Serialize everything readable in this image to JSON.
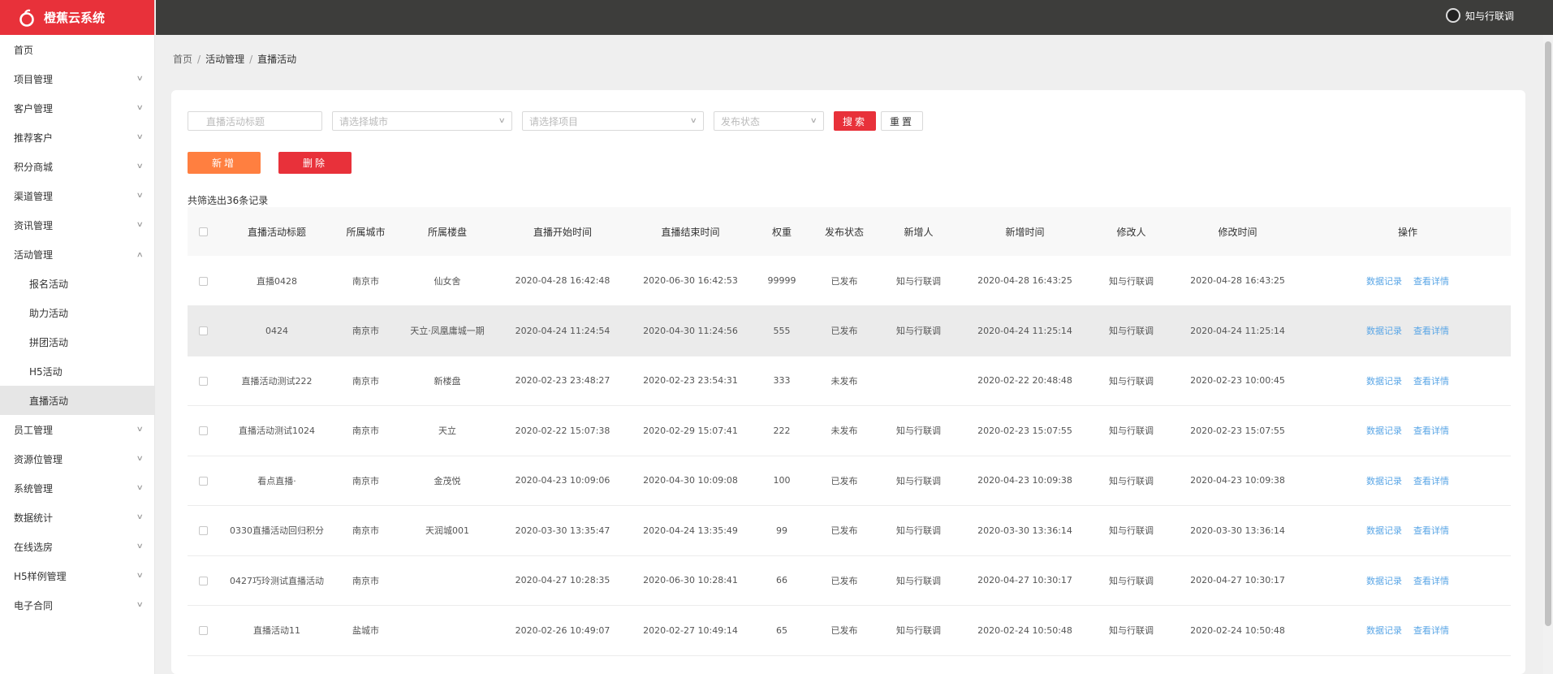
{
  "app": {
    "title": "橙蕉云系统"
  },
  "user": {
    "name": "知与行联调"
  },
  "sidebar": {
    "items": [
      {
        "label": "首页",
        "has_arrow": false
      },
      {
        "label": "项目管理",
        "has_arrow": true
      },
      {
        "label": "客户管理",
        "has_arrow": true
      },
      {
        "label": "推荐客户",
        "has_arrow": true
      },
      {
        "label": "积分商城",
        "has_arrow": true
      },
      {
        "label": "渠道管理",
        "has_arrow": true
      },
      {
        "label": "资讯管理",
        "has_arrow": true
      },
      {
        "label": "活动管理",
        "has_arrow": true,
        "open": true,
        "children": [
          "报名活动",
          "助力活动",
          "拼团活动",
          "H5活动",
          "直播活动"
        ],
        "active_child": 4
      },
      {
        "label": "员工管理",
        "has_arrow": true
      },
      {
        "label": "资源位管理",
        "has_arrow": true
      },
      {
        "label": "系统管理",
        "has_arrow": true
      },
      {
        "label": "数据统计",
        "has_arrow": true
      },
      {
        "label": "在线选房",
        "has_arrow": true
      },
      {
        "label": "H5样例管理",
        "has_arrow": true
      },
      {
        "label": "电子合同",
        "has_arrow": true
      }
    ]
  },
  "breadcrumb": [
    "首页",
    "活动管理",
    "直播活动"
  ],
  "filters": {
    "title_placeholder": "直播活动标题",
    "city_placeholder": "请选择城市",
    "project_placeholder": "请选择项目",
    "status_placeholder": "发布状态",
    "search_label": "搜索",
    "reset_label": "重置"
  },
  "toolbar": {
    "add_label": "新增",
    "delete_label": "删除"
  },
  "count_text": "共筛选出36条记录",
  "table": {
    "headers": [
      "直播活动标题",
      "所属城市",
      "所属楼盘",
      "直播开始时间",
      "直播结束时间",
      "权重",
      "发布状态",
      "新增人",
      "新增时间",
      "修改人",
      "修改时间",
      "操作"
    ],
    "action_labels": [
      "数据记录",
      "查看详情"
    ],
    "rows": [
      [
        "直播0428",
        "南京市",
        "仙女舍",
        "2020-04-28 16:42:48",
        "2020-06-30 16:42:53",
        "99999",
        "已发布",
        "知与行联调",
        "2020-04-28 16:43:25",
        "知与行联调",
        "2020-04-28 16:43:25"
      ],
      [
        "0424",
        "南京市",
        "天立·凤凰庸城一期",
        "2020-04-24 11:24:54",
        "2020-04-30 11:24:56",
        "555",
        "已发布",
        "知与行联调",
        "2020-04-24 11:25:14",
        "知与行联调",
        "2020-04-24 11:25:14"
      ],
      [
        "直播活动测试222",
        "南京市",
        "新楼盘",
        "2020-02-23 23:48:27",
        "2020-02-23 23:54:31",
        "333",
        "未发布",
        "",
        "2020-02-22 20:48:48",
        "知与行联调",
        "2020-02-23 10:00:45"
      ],
      [
        "直播活动测试1024",
        "南京市",
        "天立",
        "2020-02-22 15:07:38",
        "2020-02-29 15:07:41",
        "222",
        "未发布",
        "知与行联调",
        "2020-02-23 15:07:55",
        "知与行联调",
        "2020-02-23 15:07:55"
      ],
      [
        "看点直播·",
        "南京市",
        "金茂悦",
        "2020-04-23 10:09:06",
        "2020-04-30 10:09:08",
        "100",
        "已发布",
        "知与行联调",
        "2020-04-23 10:09:38",
        "知与行联调",
        "2020-04-23 10:09:38"
      ],
      [
        "0330直播活动回归积分",
        "南京市",
        "天润城001",
        "2020-03-30 13:35:47",
        "2020-04-24 13:35:49",
        "99",
        "已发布",
        "知与行联调",
        "2020-03-30 13:36:14",
        "知与行联调",
        "2020-03-30 13:36:14"
      ],
      [
        "0427巧玲测试直播活动",
        "南京市",
        "",
        "2020-04-27 10:28:35",
        "2020-06-30 10:28:41",
        "66",
        "已发布",
        "知与行联调",
        "2020-04-27 10:30:17",
        "知与行联调",
        "2020-04-27 10:30:17"
      ],
      [
        "直播活动11",
        "盐城市",
        "",
        "2020-02-26 10:49:07",
        "2020-02-27 10:49:14",
        "65",
        "已发布",
        "知与行联调",
        "2020-02-24 10:50:48",
        "知与行联调",
        "2020-02-24 10:50:48"
      ]
    ],
    "highlight_row": 1
  },
  "colors": {
    "brand": "#e8313a",
    "add": "#ff7f40",
    "link": "#5aa6e6",
    "topbar": "#3d3d3b"
  }
}
